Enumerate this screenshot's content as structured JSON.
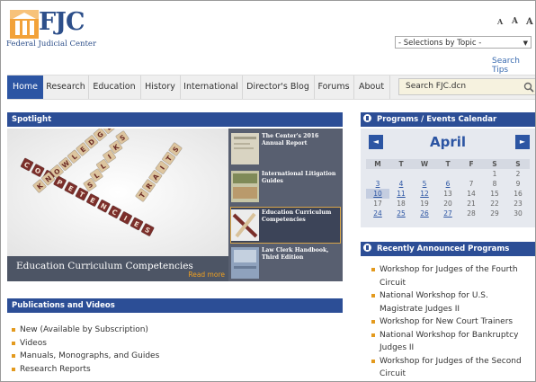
{
  "header": {
    "logo_text": "FJC",
    "logo_subtitle": "Federal Judicial Center",
    "text_size_buttons": [
      "A",
      "A",
      "A"
    ],
    "topic_select": "- Selections by Topic -",
    "search_tips": "Search Tips"
  },
  "nav": {
    "items": [
      "Home",
      "Research",
      "Education",
      "History",
      "International",
      "Director's Blog",
      "Forums",
      "About"
    ],
    "active": "Home",
    "search_placeholder": "Search FJC.dcn"
  },
  "spotlight": {
    "title": "Spotlight",
    "hero_title": "Education Curriculum Competencies",
    "read_more": "Read more",
    "tiles": [
      "COMPETENCIES",
      "SKILLS",
      "KNOWLEDGE",
      "TRAITS"
    ],
    "thumbs": [
      {
        "title": "The Center's 2016 Annual Report",
        "active": false
      },
      {
        "title": "International Litigation Guides",
        "active": false
      },
      {
        "title": "Education Curriculum Competencies",
        "active": true
      },
      {
        "title": "Law Clerk Handbook, Third Edition",
        "active": false
      }
    ]
  },
  "calendar": {
    "title": "Programs / Events Calendar",
    "month": "April",
    "prev": "◄",
    "next": "►",
    "weekdays": [
      "M",
      "T",
      "W",
      "T",
      "F",
      "S",
      "S"
    ],
    "weeks": [
      [
        "",
        "",
        "",
        "",
        "",
        "1",
        "2"
      ],
      [
        "3",
        "4",
        "5",
        "6",
        "7",
        "8",
        "9"
      ],
      [
        "10",
        "11",
        "12",
        "13",
        "14",
        "15",
        "16"
      ],
      [
        "17",
        "18",
        "19",
        "20",
        "21",
        "22",
        "23"
      ],
      [
        "24",
        "25",
        "26",
        "27",
        "28",
        "29",
        "30"
      ]
    ],
    "linked_days": [
      "3",
      "4",
      "5",
      "6",
      "10",
      "11",
      "12",
      "24",
      "25",
      "26",
      "27"
    ],
    "today": "10"
  },
  "programs": {
    "title": "Recently Announced Programs",
    "items": [
      "Workshop for Judges of the Fourth Circuit",
      "National Workshop for U.S. Magistrate Judges II",
      "Workshop for New Court Trainers",
      "National Workshop for Bankruptcy Judges II",
      "Workshop for Judges of the Second Circuit"
    ]
  },
  "publications": {
    "title": "Publications and Videos",
    "items": [
      "New (Available by Subscription)",
      "Videos",
      "Manuals, Monographs, and Guides",
      "Research Reports"
    ]
  },
  "colors": {
    "brand_blue": "#2c55a3",
    "header_bar": "#2c4e96",
    "accent_orange": "#e39a1e",
    "search_bg": "#f6f2df"
  }
}
